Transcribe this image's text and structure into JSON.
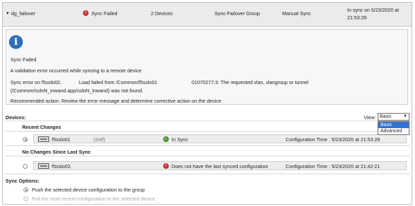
{
  "header": {
    "group_name": "dg_failover",
    "status": "Sync Failed",
    "device_count": "2 Devices",
    "group_type": "Sync-Failover Group",
    "sync_type": "Manual Sync",
    "in_sync_line1": "In sync on 5/23/2020 at",
    "in_sync_line2": "21:53:28"
  },
  "alert": {
    "icon": "info-icon",
    "title": "Sync Failed",
    "message": "A validation error occurred while syncing to a remote device",
    "error_a": "Sync error on f5sslo02.",
    "error_b": "Load failed from /Common/f5sslo01",
    "error_c": "01070277:3: The requested vlan, vlangroup or tunnel",
    "error_line2": "(/Common/ssloN_inwand.app/ssloN_inwand) was not found.",
    "recommended": "Recommended action: Review the error message and determine corrective action on the device"
  },
  "devices": {
    "label": "Devices:",
    "view_label": "View:",
    "view_selected": "Basic",
    "view_options": [
      "Basic",
      "Advanced"
    ],
    "recent_changes_label": "Recent Changes",
    "no_changes_label": "No Changes Since Last Sync",
    "rows": [
      {
        "name": "f5sslo01",
        "self": "(Self)",
        "status": "In Sync",
        "status_color": "#4aa834",
        "config_time": "Configuration Time : 5/23/2020 at 21:53:28"
      },
      {
        "name": "f5sslo02.",
        "status": "Does not have the last synced configuration",
        "status_color": "#d9362e",
        "config_time": "Configuration Time : 5/23/2020 at 21:42:21"
      }
    ]
  },
  "sync_options": {
    "label": "Sync Options:",
    "option_push": "Push the selected device configuration to the group",
    "option_pull": "Pull the most recent configuration to the selected device"
  }
}
